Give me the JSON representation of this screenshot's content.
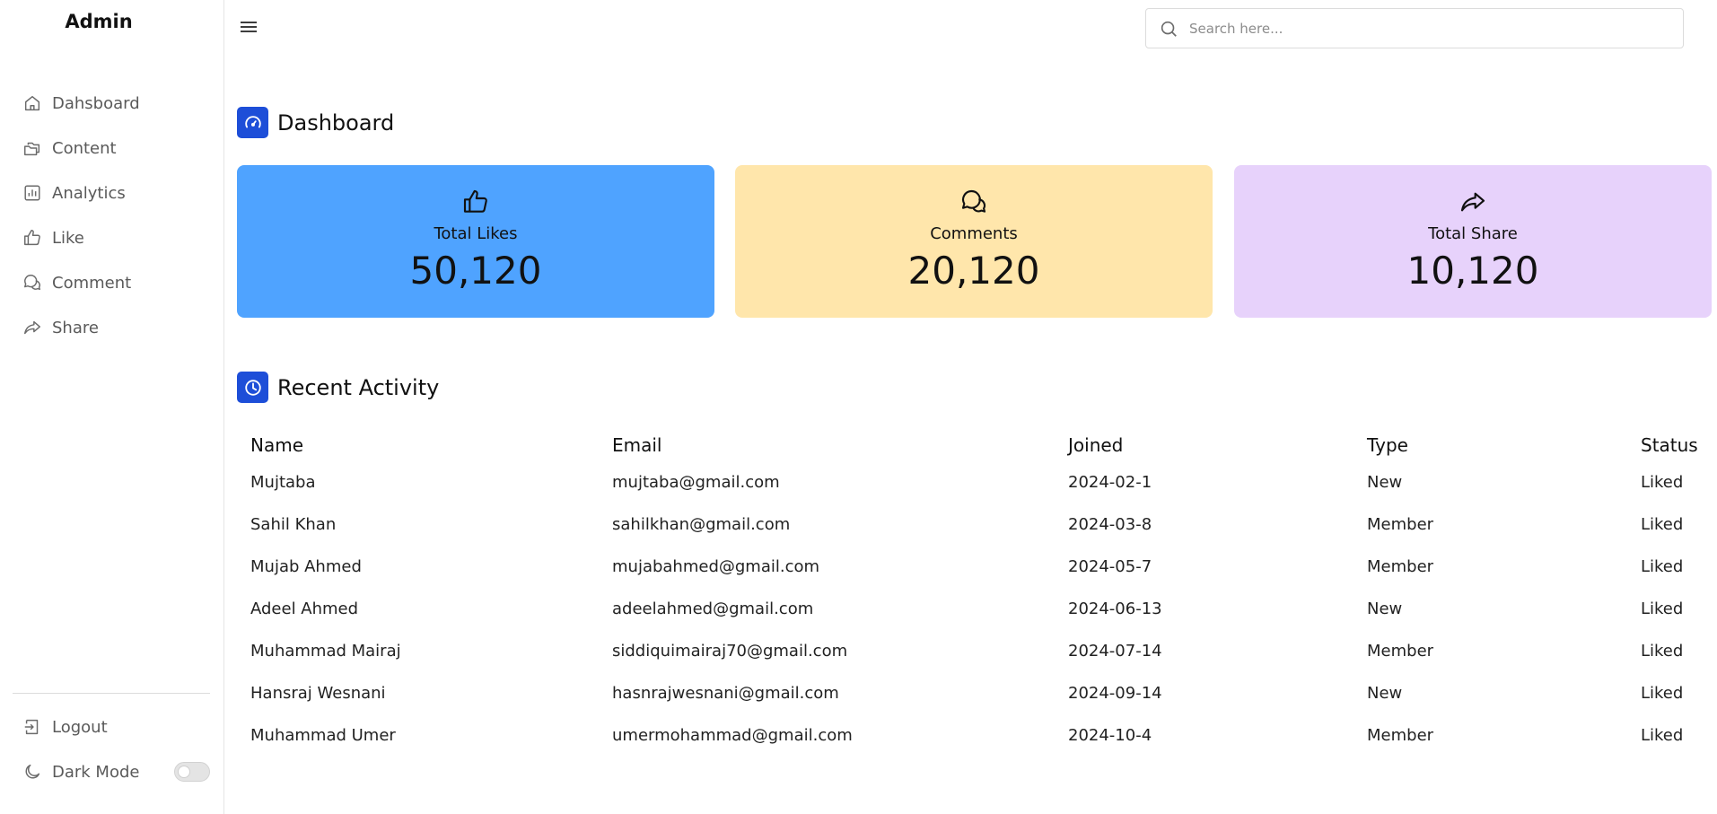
{
  "sidebar": {
    "brand": "Admin",
    "items": [
      {
        "label": "Dahsboard",
        "icon": "home-icon"
      },
      {
        "label": "Content",
        "icon": "folders-icon"
      },
      {
        "label": "Analytics",
        "icon": "bar-chart-icon"
      },
      {
        "label": "Like",
        "icon": "thumbs-up-icon"
      },
      {
        "label": "Comment",
        "icon": "comments-icon"
      },
      {
        "label": "Share",
        "icon": "share-icon"
      }
    ],
    "logout": "Logout",
    "dark_mode": "Dark Mode"
  },
  "header": {
    "search_placeholder": "Search here..."
  },
  "dashboard": {
    "title": "Dashboard",
    "cards": [
      {
        "label": "Total Likes",
        "value": "50,120",
        "color": "#4fa3ff"
      },
      {
        "label": "Comments",
        "value": "20,120",
        "color": "#ffe6ab"
      },
      {
        "label": "Total Share",
        "value": "10,120",
        "color": "#e7d2fb"
      }
    ]
  },
  "activity": {
    "title": "Recent Activity",
    "columns": [
      "Name",
      "Email",
      "Joined",
      "Type",
      "Status"
    ],
    "rows": [
      [
        "Mujtaba",
        "mujtaba@gmail.com",
        "2024-02-1",
        "New",
        "Liked"
      ],
      [
        "Sahil Khan",
        "sahilkhan@gmail.com",
        "2024-03-8",
        "Member",
        "Liked"
      ],
      [
        "Mujab Ahmed",
        "mujabahmed@gmail.com",
        "2024-05-7",
        "Member",
        "Liked"
      ],
      [
        "Adeel Ahmed",
        "adeelahmed@gmail.com",
        "2024-06-13",
        "New",
        "Liked"
      ],
      [
        "Muhammad Mairaj",
        "siddiquimairaj70@gmail.com",
        "2024-07-14",
        "Member",
        "Liked"
      ],
      [
        "Hansraj Wesnani",
        "hasnrajwesnani@gmail.com",
        "2024-09-14",
        "New",
        "Liked"
      ],
      [
        "Muhammad Umer",
        "umermohammad@gmail.com",
        "2024-10-4",
        "Member",
        "Liked"
      ]
    ]
  },
  "colors": {
    "accent": "#1d4ed8"
  }
}
